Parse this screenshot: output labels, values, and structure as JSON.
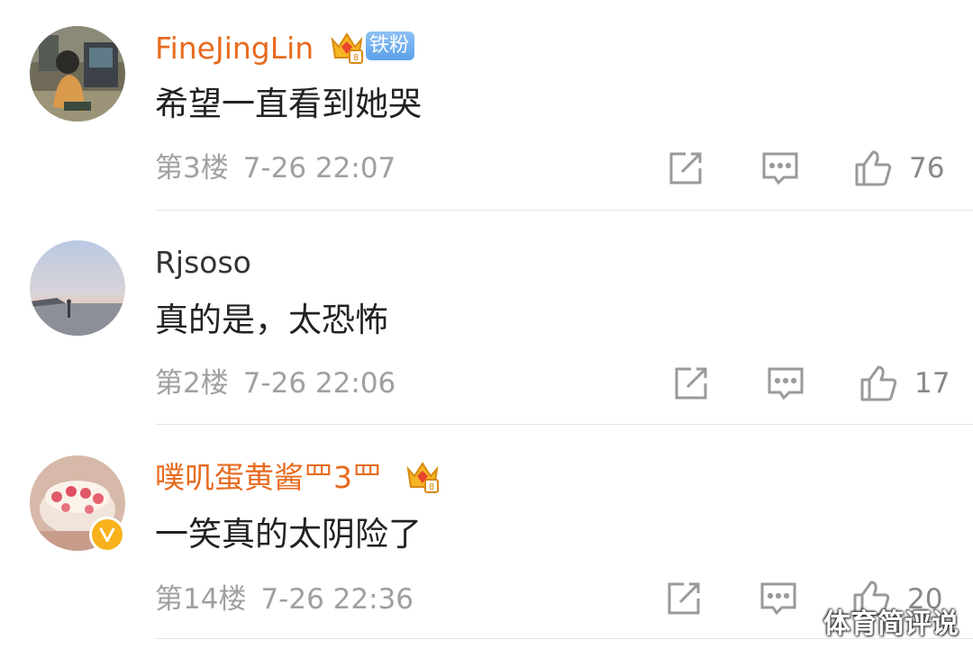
{
  "comments": [
    {
      "username": "FineJingLin",
      "badge": "铁粉",
      "content": "希望一直看到她哭",
      "floor": "第3楼",
      "time": "7-26 22:07",
      "likes": "76"
    },
    {
      "username": "Rjsoso",
      "content": "真的是，太恐怖",
      "floor": "第2楼",
      "time": "7-26 22:06",
      "likes": "17"
    },
    {
      "username": "噗叽蛋黄酱罒3罒",
      "content": "一笑真的太阴险了",
      "floor": "第14楼",
      "time": "7-26 22:36",
      "likes": "20"
    }
  ],
  "watermark": "体育简评说",
  "colors": {
    "vip_name": "#e86a1f",
    "normal_name": "#333333",
    "meta": "#a0a0a0",
    "fan_badge": "#6aa9ee",
    "verified_badge": "#f8b21b"
  },
  "icons": [
    "crown-vip-icon",
    "share-icon",
    "reply-icon",
    "like-icon",
    "verified-icon"
  ]
}
